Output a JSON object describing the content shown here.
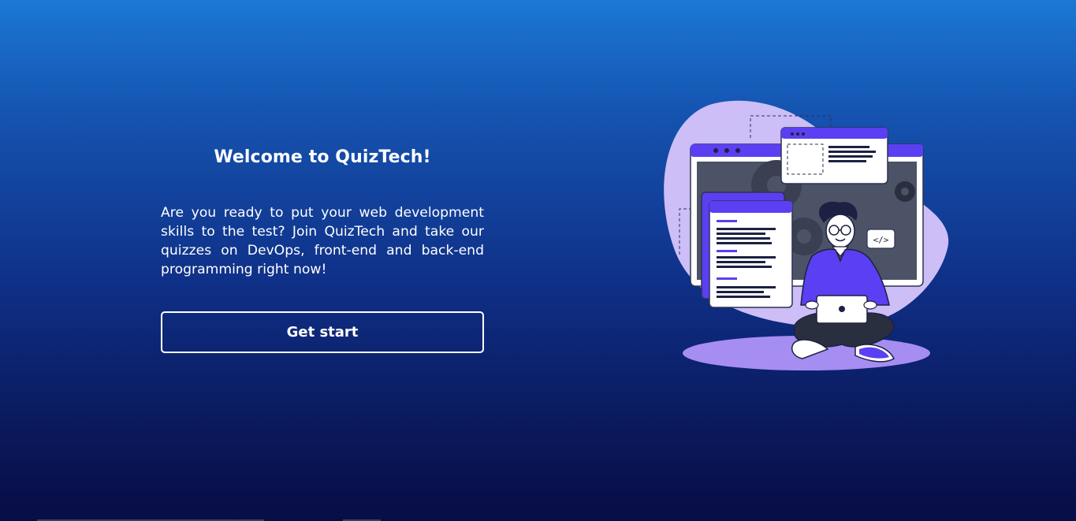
{
  "hero": {
    "title": "Welcome to QuizTech!",
    "description": "Are you ready to put your web development skills to the test? Join QuizTech and take our quizzes on DevOps, front-end and back-end programming right now!",
    "cta_label": "Get start"
  },
  "illustration": {
    "code_tag": "</>"
  },
  "colors": {
    "background_top": "#1b78d4",
    "background_bottom": "#080d45",
    "accent_purple": "#5b3ff2",
    "blob_lavender": "#cdbef7",
    "button_border": "#ffffff"
  }
}
